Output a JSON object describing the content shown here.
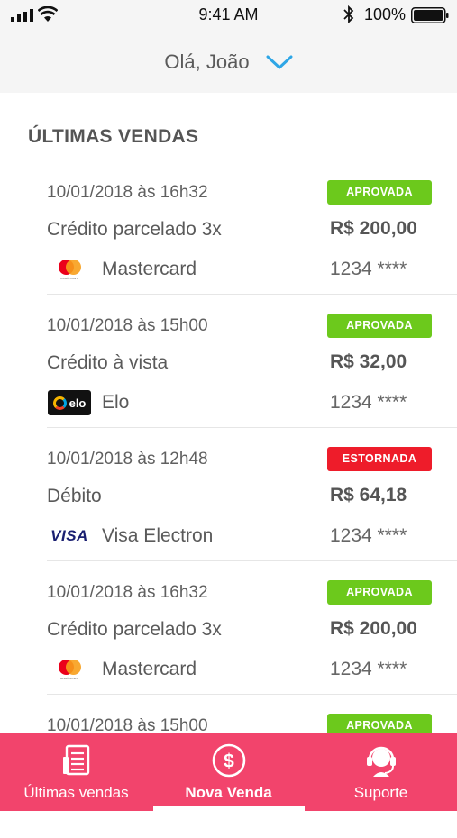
{
  "status_bar": {
    "time": "9:41 AM",
    "battery": "100%"
  },
  "header": {
    "greeting": "Olá, João"
  },
  "section_title": "ÚLTIMAS VENDAS",
  "sales": [
    {
      "date": "10/01/2018 às 16h32",
      "status": "APROVADA",
      "status_color": "#6cc91c",
      "type": "Crédito parcelado 3x",
      "amount": "R$ 200,00",
      "brand": "Mastercard",
      "logo": "mastercard-logo",
      "card": "1234 ****"
    },
    {
      "date": "10/01/2018 às 15h00",
      "status": "APROVADA",
      "status_color": "#6cc91c",
      "type": "Crédito à vista",
      "amount": "R$ 32,00",
      "brand": "Elo",
      "logo": "elo-logo",
      "card": "1234 ****"
    },
    {
      "date": "10/01/2018 às 12h48",
      "status": "ESTORNADA",
      "status_color": "#ee1c2a",
      "type": "Débito",
      "amount": "R$ 64,18",
      "brand": "Visa Electron",
      "logo": "visa-logo",
      "card": "1234 ****"
    },
    {
      "date": "10/01/2018 às 16h32",
      "status": "APROVADA",
      "status_color": "#6cc91c",
      "type": "Crédito parcelado 3x",
      "amount": "R$ 200,00",
      "brand": "Mastercard",
      "logo": "mastercard-logo",
      "card": "1234 ****"
    },
    {
      "date": "10/01/2018 às 15h00",
      "status": "APROVADA",
      "status_color": "#6cc91c",
      "type": "",
      "amount": "",
      "brand": "",
      "logo": "",
      "card": ""
    }
  ],
  "tabs": [
    {
      "label": "Últimas vendas",
      "icon": "receipt-list-icon",
      "active": false
    },
    {
      "label": "Nova Venda",
      "icon": "dollar-circle-icon",
      "active": true
    },
    {
      "label": "Suporte",
      "icon": "headset-icon",
      "active": false
    }
  ],
  "colors": {
    "accent": "#f2446c",
    "chevron": "#2ea6e6",
    "approved": "#6cc91c",
    "reversed": "#ee1c2a"
  }
}
